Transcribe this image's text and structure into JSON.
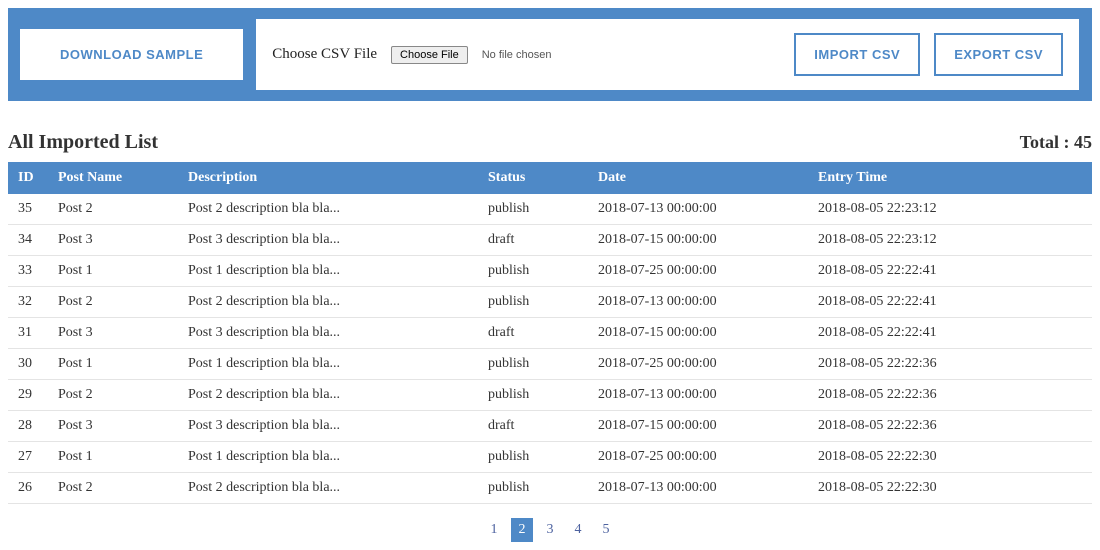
{
  "toolbar": {
    "download_sample": "DOWNLOAD SAMPLE",
    "choose_label": "Choose CSV File",
    "choose_file_btn": "Choose File",
    "no_file": "No file chosen",
    "import_csv": "IMPORT CSV",
    "export_csv": "EXPORT CSV"
  },
  "list": {
    "title": "All Imported List",
    "total_label": "Total : 45",
    "columns": {
      "id": "ID",
      "post_name": "Post Name",
      "description": "Description",
      "status": "Status",
      "date": "Date",
      "entry_time": "Entry Time"
    },
    "rows": [
      {
        "id": "35",
        "name": "Post 2",
        "desc": "Post 2 description bla bla...",
        "status": "publish",
        "date": "2018-07-13 00:00:00",
        "entry": "2018-08-05 22:23:12"
      },
      {
        "id": "34",
        "name": "Post 3",
        "desc": "Post 3 description bla bla...",
        "status": "draft",
        "date": "2018-07-15 00:00:00",
        "entry": "2018-08-05 22:23:12"
      },
      {
        "id": "33",
        "name": "Post 1",
        "desc": "Post 1 description bla bla...",
        "status": "publish",
        "date": "2018-07-25 00:00:00",
        "entry": "2018-08-05 22:22:41"
      },
      {
        "id": "32",
        "name": "Post 2",
        "desc": "Post 2 description bla bla...",
        "status": "publish",
        "date": "2018-07-13 00:00:00",
        "entry": "2018-08-05 22:22:41"
      },
      {
        "id": "31",
        "name": "Post 3",
        "desc": "Post 3 description bla bla...",
        "status": "draft",
        "date": "2018-07-15 00:00:00",
        "entry": "2018-08-05 22:22:41"
      },
      {
        "id": "30",
        "name": "Post 1",
        "desc": "Post 1 description bla bla...",
        "status": "publish",
        "date": "2018-07-25 00:00:00",
        "entry": "2018-08-05 22:22:36"
      },
      {
        "id": "29",
        "name": "Post 2",
        "desc": "Post 2 description bla bla...",
        "status": "publish",
        "date": "2018-07-13 00:00:00",
        "entry": "2018-08-05 22:22:36"
      },
      {
        "id": "28",
        "name": "Post 3",
        "desc": "Post 3 description bla bla...",
        "status": "draft",
        "date": "2018-07-15 00:00:00",
        "entry": "2018-08-05 22:22:36"
      },
      {
        "id": "27",
        "name": "Post 1",
        "desc": "Post 1 description bla bla...",
        "status": "publish",
        "date": "2018-07-25 00:00:00",
        "entry": "2018-08-05 22:22:30"
      },
      {
        "id": "26",
        "name": "Post 2",
        "desc": "Post 2 description bla bla...",
        "status": "publish",
        "date": "2018-07-13 00:00:00",
        "entry": "2018-08-05 22:22:30"
      }
    ]
  },
  "pagination": {
    "pages": [
      "1",
      "2",
      "3",
      "4",
      "5"
    ],
    "active_index": 1
  }
}
